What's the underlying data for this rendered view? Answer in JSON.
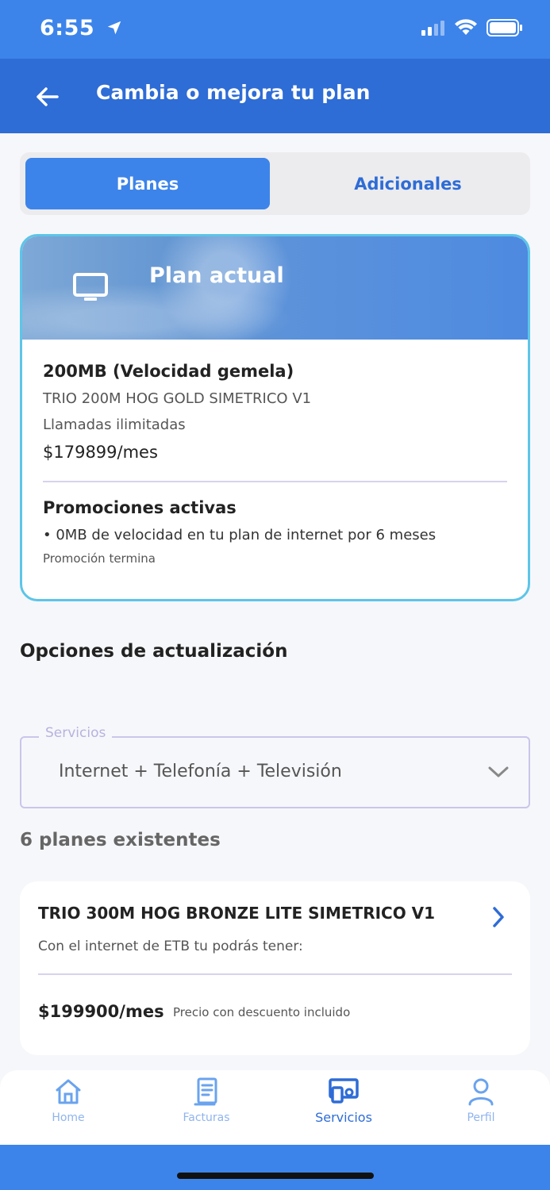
{
  "status_bar": {
    "time": "6:55"
  },
  "appbar": {
    "title": "Cambia o mejora tu plan"
  },
  "tabs": [
    {
      "label": "Planes"
    },
    {
      "label": "Adicionales"
    }
  ],
  "current_plan": {
    "banner_title": "Plan actual",
    "name": "200MB (Velocidad gemela)",
    "code": "TRIO 200M HOG GOLD SIMETRICO V1",
    "calls": "Llamadas ilimitadas",
    "price": "$179899/mes",
    "promo_title": "Promociones activas",
    "promo_item": "• 0MB de velocidad en tu plan de internet por 6 meses",
    "promo_end": "Promoción termina"
  },
  "upgrade": {
    "title": "Opciones de actualización",
    "services_label": "Servicios",
    "services_value": "Internet + Telefonía + Televisión",
    "count_text": "6 planes existentes"
  },
  "offers": [
    {
      "name": "TRIO 300M HOG BRONZE LITE SIMETRICO V1",
      "desc": "Con el internet de ETB tu podrás tener:",
      "price": "$199900/mes",
      "note": "Precio con descuento incluido"
    }
  ],
  "bottom_nav": [
    {
      "label": "Home",
      "icon": "home-icon"
    },
    {
      "label": "Facturas",
      "icon": "invoice-icon"
    },
    {
      "label": "Servicios",
      "icon": "devices-icon",
      "active": true
    },
    {
      "label": "Perfil",
      "icon": "user-icon"
    }
  ],
  "colors": {
    "primary": "#3c84ea",
    "appbar": "#2e6cd6",
    "card_border": "#5cc5e8"
  }
}
